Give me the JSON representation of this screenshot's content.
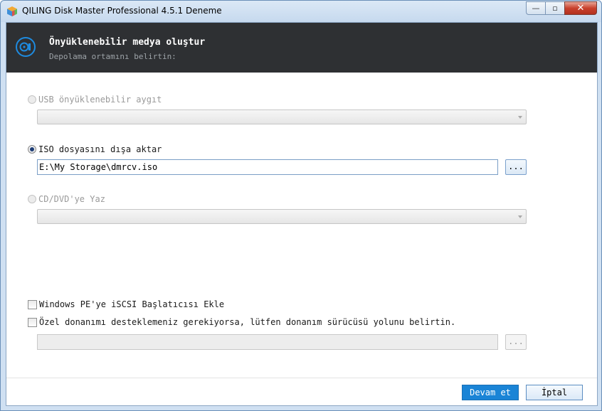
{
  "window": {
    "title": "QILING Disk Master Professional 4.5.1 Deneme",
    "minimize_glyph": "—",
    "restore_glyph": "▫",
    "close_glyph": "✕",
    "icon": "app-cube-icon"
  },
  "header": {
    "title": "Önyüklenebilir medya oluştur",
    "subtitle": "Depolama ortamını belirtin:",
    "icon": "disc-media-icon"
  },
  "options": {
    "usb": {
      "label": "USB önyüklenebilir aygıt",
      "selected": false,
      "enabled": false
    },
    "iso": {
      "label": "ISO dosyasını dışa aktar",
      "selected": true,
      "enabled": true,
      "path": "E:\\My Storage\\dmrcv.iso",
      "browse_label": "..."
    },
    "cd": {
      "label": "CD/DVD'ye Yaz",
      "selected": false,
      "enabled": false
    }
  },
  "checks": {
    "iscsi": {
      "label": "Windows PE'ye iSCSI Başlatıcısı Ekle",
      "checked": false
    },
    "driver": {
      "label": "Özel donanımı desteklemeniz gerekiyorsa, lütfen donanım sürücüsü yolunu belirtin.",
      "checked": false,
      "path": "",
      "browse_label": "..."
    }
  },
  "footer": {
    "next_label": "Devam et",
    "cancel_label": "İptal"
  },
  "colors": {
    "header_bg": "#2e3033",
    "accent": "#1a84d6"
  }
}
